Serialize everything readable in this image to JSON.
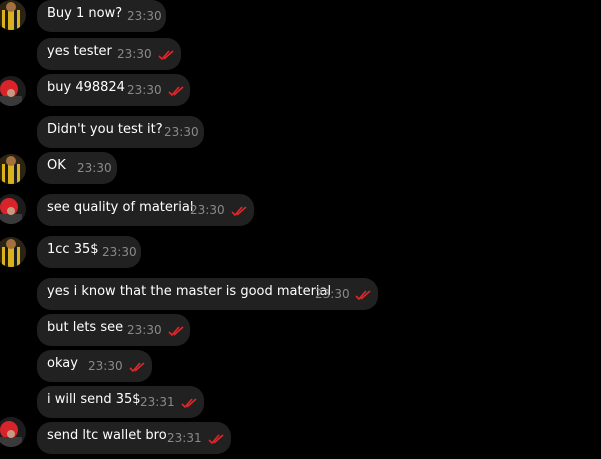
{
  "colors": {
    "background": "#000000",
    "bubble": "#212121",
    "text": "#ffffff",
    "time": "#8a8a8a",
    "read_check": "#e0262b"
  },
  "messages": [
    {
      "text": "Buy 1 now?",
      "time": "23:30",
      "avatar": "avatar-yellow"
    },
    {
      "text": "yes tester",
      "time": "23:30",
      "check": "double-check-icon"
    },
    {
      "text": "buy 498824",
      "time": "23:30",
      "check": "double-check-icon",
      "avatar": "avatar-red"
    },
    {
      "text": "Didn't you test it?",
      "time": "23:30"
    },
    {
      "text": "OK",
      "time": "23:30",
      "avatar": "avatar-yellow"
    },
    {
      "text": "see quality of material",
      "time": "23:30",
      "check": "double-check-icon",
      "avatar": "avatar-red"
    },
    {
      "text": "1cc 35$",
      "time": "23:30",
      "avatar": "avatar-yellow"
    },
    {
      "text": "yes i know that the master is good material",
      "time": "23:30",
      "check": "double-check-icon"
    },
    {
      "text": "but lets see",
      "time": "23:30",
      "check": "double-check-icon"
    },
    {
      "text": "okay",
      "time": "23:30",
      "check": "double-check-icon"
    },
    {
      "text": "i will send 35$",
      "time": "23:31",
      "check": "double-check-icon"
    },
    {
      "text": "send ltc wallet bro",
      "time": "23:31",
      "check": "double-check-icon",
      "avatar": "avatar-red"
    }
  ]
}
